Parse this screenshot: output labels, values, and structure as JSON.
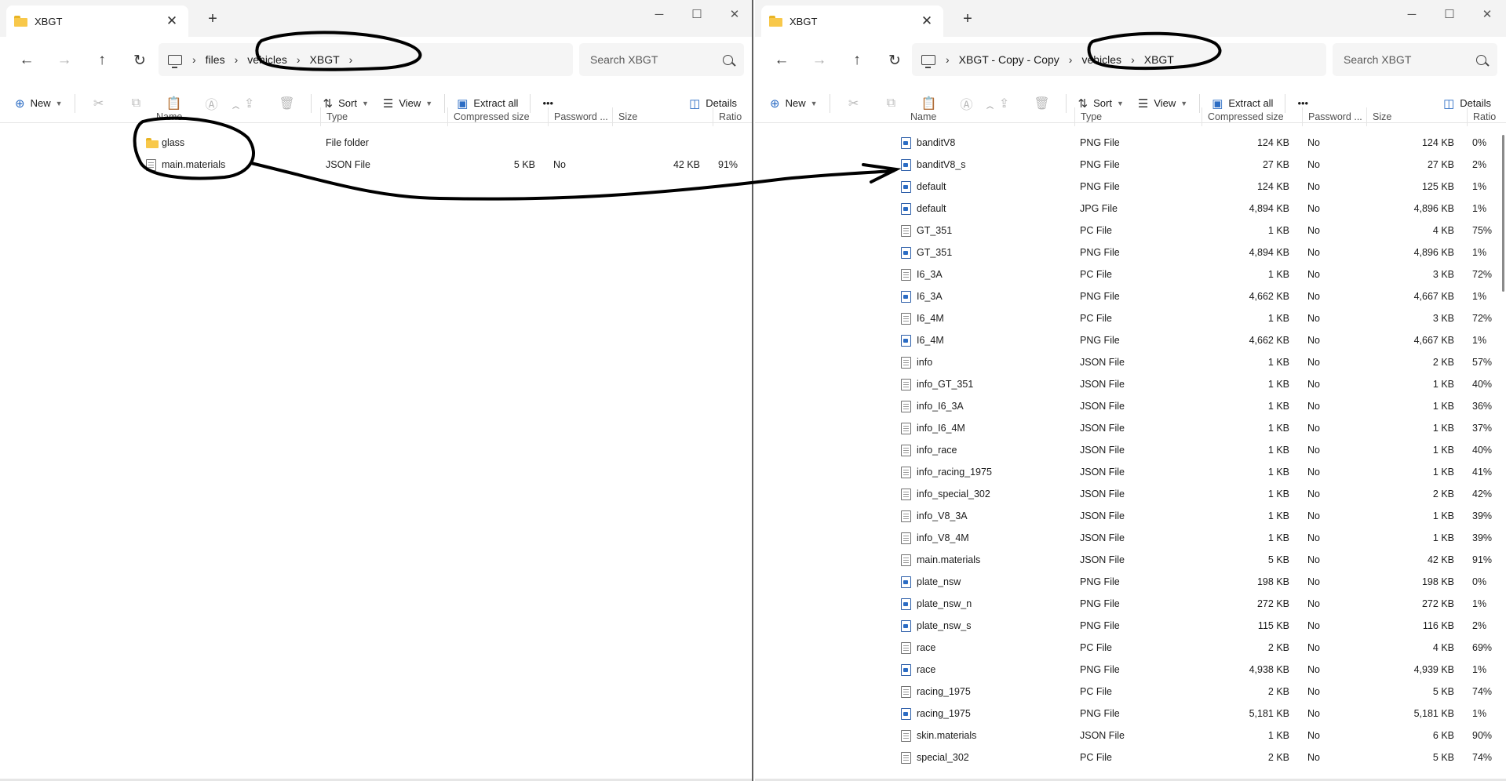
{
  "left": {
    "tab_title": "XBGT",
    "breadcrumb": [
      "files",
      "vehicles",
      "XBGT"
    ],
    "search_placeholder": "Search XBGT",
    "toolbar": {
      "new": "New",
      "sort": "Sort",
      "view": "View",
      "extract": "Extract all",
      "more": "•••",
      "details": "Details"
    },
    "columns": [
      "Name",
      "Type",
      "Compressed size",
      "Password ...",
      "Size",
      "Ratio"
    ],
    "files": [
      {
        "name": "glass",
        "type": "File folder",
        "compressed": "",
        "password": "",
        "size": "",
        "ratio": "",
        "icon": "folder-icon"
      },
      {
        "name": "main.materials",
        "type": "JSON File",
        "compressed": "5 KB",
        "password": "No",
        "size": "42 KB",
        "ratio": "91%",
        "icon": "file-icon"
      }
    ]
  },
  "right": {
    "tab_title": "XBGT",
    "breadcrumb": [
      "XBGT - Copy - Copy",
      "vehicles",
      "XBGT"
    ],
    "search_placeholder": "Search XBGT",
    "toolbar": {
      "new": "New",
      "sort": "Sort",
      "view": "View",
      "extract": "Extract all",
      "more": "•••",
      "details": "Details"
    },
    "columns": [
      "Name",
      "Type",
      "Compressed size",
      "Password ...",
      "Size",
      "Ratio"
    ],
    "files": [
      {
        "name": "banditV8",
        "type": "PNG File",
        "compressed": "124 KB",
        "password": "No",
        "size": "124 KB",
        "ratio": "0%",
        "icon": "image-file-icon"
      },
      {
        "name": "banditV8_s",
        "type": "PNG File",
        "compressed": "27 KB",
        "password": "No",
        "size": "27 KB",
        "ratio": "2%",
        "icon": "image-file-icon"
      },
      {
        "name": "default",
        "type": "PNG File",
        "compressed": "124 KB",
        "password": "No",
        "size": "125 KB",
        "ratio": "1%",
        "icon": "image-file-icon"
      },
      {
        "name": "default",
        "type": "JPG File",
        "compressed": "4,894 KB",
        "password": "No",
        "size": "4,896 KB",
        "ratio": "1%",
        "icon": "image-file-icon"
      },
      {
        "name": "GT_351",
        "type": "PC File",
        "compressed": "1 KB",
        "password": "No",
        "size": "4 KB",
        "ratio": "75%",
        "icon": "file-icon"
      },
      {
        "name": "GT_351",
        "type": "PNG File",
        "compressed": "4,894 KB",
        "password": "No",
        "size": "4,896 KB",
        "ratio": "1%",
        "icon": "image-file-icon"
      },
      {
        "name": "I6_3A",
        "type": "PC File",
        "compressed": "1 KB",
        "password": "No",
        "size": "3 KB",
        "ratio": "72%",
        "icon": "file-icon"
      },
      {
        "name": "I6_3A",
        "type": "PNG File",
        "compressed": "4,662 KB",
        "password": "No",
        "size": "4,667 KB",
        "ratio": "1%",
        "icon": "image-file-icon"
      },
      {
        "name": "I6_4M",
        "type": "PC File",
        "compressed": "1 KB",
        "password": "No",
        "size": "3 KB",
        "ratio": "72%",
        "icon": "file-icon"
      },
      {
        "name": "I6_4M",
        "type": "PNG File",
        "compressed": "4,662 KB",
        "password": "No",
        "size": "4,667 KB",
        "ratio": "1%",
        "icon": "image-file-icon"
      },
      {
        "name": "info",
        "type": "JSON File",
        "compressed": "1 KB",
        "password": "No",
        "size": "2 KB",
        "ratio": "57%",
        "icon": "file-icon"
      },
      {
        "name": "info_GT_351",
        "type": "JSON File",
        "compressed": "1 KB",
        "password": "No",
        "size": "1 KB",
        "ratio": "40%",
        "icon": "file-icon"
      },
      {
        "name": "info_I6_3A",
        "type": "JSON File",
        "compressed": "1 KB",
        "password": "No",
        "size": "1 KB",
        "ratio": "36%",
        "icon": "file-icon"
      },
      {
        "name": "info_I6_4M",
        "type": "JSON File",
        "compressed": "1 KB",
        "password": "No",
        "size": "1 KB",
        "ratio": "37%",
        "icon": "file-icon"
      },
      {
        "name": "info_race",
        "type": "JSON File",
        "compressed": "1 KB",
        "password": "No",
        "size": "1 KB",
        "ratio": "40%",
        "icon": "file-icon"
      },
      {
        "name": "info_racing_1975",
        "type": "JSON File",
        "compressed": "1 KB",
        "password": "No",
        "size": "1 KB",
        "ratio": "41%",
        "icon": "file-icon"
      },
      {
        "name": "info_special_302",
        "type": "JSON File",
        "compressed": "1 KB",
        "password": "No",
        "size": "2 KB",
        "ratio": "42%",
        "icon": "file-icon"
      },
      {
        "name": "info_V8_3A",
        "type": "JSON File",
        "compressed": "1 KB",
        "password": "No",
        "size": "1 KB",
        "ratio": "39%",
        "icon": "file-icon"
      },
      {
        "name": "info_V8_4M",
        "type": "JSON File",
        "compressed": "1 KB",
        "password": "No",
        "size": "1 KB",
        "ratio": "39%",
        "icon": "file-icon"
      },
      {
        "name": "main.materials",
        "type": "JSON File",
        "compressed": "5 KB",
        "password": "No",
        "size": "42 KB",
        "ratio": "91%",
        "icon": "file-icon"
      },
      {
        "name": "plate_nsw",
        "type": "PNG File",
        "compressed": "198 KB",
        "password": "No",
        "size": "198 KB",
        "ratio": "0%",
        "icon": "image-file-icon"
      },
      {
        "name": "plate_nsw_n",
        "type": "PNG File",
        "compressed": "272 KB",
        "password": "No",
        "size": "272 KB",
        "ratio": "1%",
        "icon": "image-file-icon"
      },
      {
        "name": "plate_nsw_s",
        "type": "PNG File",
        "compressed": "115 KB",
        "password": "No",
        "size": "116 KB",
        "ratio": "2%",
        "icon": "image-file-icon"
      },
      {
        "name": "race",
        "type": "PC File",
        "compressed": "2 KB",
        "password": "No",
        "size": "4 KB",
        "ratio": "69%",
        "icon": "file-icon"
      },
      {
        "name": "race",
        "type": "PNG File",
        "compressed": "4,938 KB",
        "password": "No",
        "size": "4,939 KB",
        "ratio": "1%",
        "icon": "image-file-icon"
      },
      {
        "name": "racing_1975",
        "type": "PC File",
        "compressed": "2 KB",
        "password": "No",
        "size": "5 KB",
        "ratio": "74%",
        "icon": "file-icon"
      },
      {
        "name": "racing_1975",
        "type": "PNG File",
        "compressed": "5,181 KB",
        "password": "No",
        "size": "5,181 KB",
        "ratio": "1%",
        "icon": "image-file-icon"
      },
      {
        "name": "skin.materials",
        "type": "JSON File",
        "compressed": "1 KB",
        "password": "No",
        "size": "6 KB",
        "ratio": "90%",
        "icon": "file-icon"
      },
      {
        "name": "special_302",
        "type": "PC File",
        "compressed": "2 KB",
        "password": "No",
        "size": "5 KB",
        "ratio": "74%",
        "icon": "file-icon"
      }
    ]
  },
  "colors": {
    "annotation": "#000000",
    "accent": "#2b6cc4",
    "folder": "#f8c84a"
  }
}
